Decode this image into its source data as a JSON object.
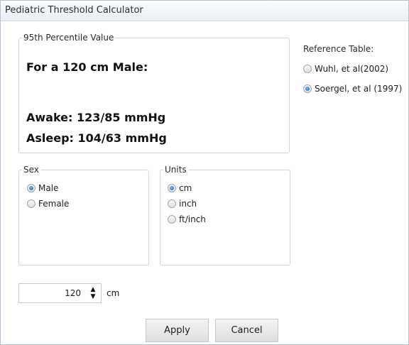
{
  "window": {
    "title": "Pediatric Threshold Calculator"
  },
  "percentile": {
    "legend": "95th Percentile Value",
    "line1": "For a 120 cm Male:",
    "line2": "Awake: 123/85 mmHg",
    "line3": "Asleep: 104/63 mmHg"
  },
  "reference": {
    "title": "Reference Table:",
    "options": [
      {
        "label": "Wuhl, et al(2002)",
        "selected": false
      },
      {
        "label": "Soergel, et al (1997)",
        "selected": true
      }
    ]
  },
  "sex": {
    "legend": "Sex",
    "options": [
      {
        "label": "Male",
        "selected": true
      },
      {
        "label": "Female",
        "selected": false
      }
    ]
  },
  "units": {
    "legend": "Units",
    "options": [
      {
        "label": "cm",
        "selected": true
      },
      {
        "label": "inch",
        "selected": false
      },
      {
        "label": "ft/inch",
        "selected": false
      }
    ]
  },
  "height_input": {
    "value": "120",
    "unit": "cm"
  },
  "buttons": {
    "apply": "Apply",
    "cancel": "Cancel"
  },
  "icons": {
    "up": "spin-up-icon",
    "down": "spin-down-icon"
  }
}
